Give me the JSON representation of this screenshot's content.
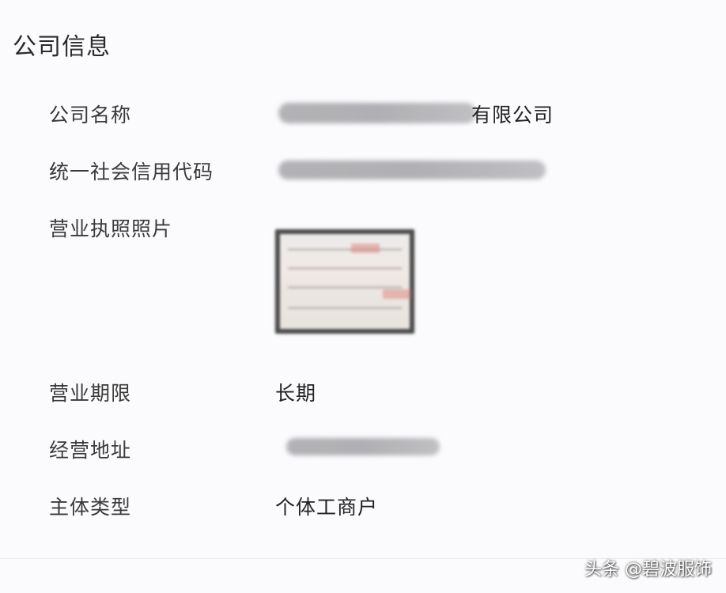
{
  "section": {
    "title": "公司信息"
  },
  "fields": [
    {
      "label": "公司名称",
      "value_visible": "有限公司",
      "redacted": true
    },
    {
      "label": "统一社会信用代码",
      "value_visible": "",
      "redacted": true
    },
    {
      "label": "营业执照照片",
      "value_visible": "",
      "redacted": true
    },
    {
      "label": "营业期限",
      "value_visible": "长期",
      "redacted": false
    },
    {
      "label": "经营地址",
      "value_visible": "",
      "redacted": true
    },
    {
      "label": "主体类型",
      "value_visible": "个体工商户",
      "redacted": false
    }
  ],
  "watermark": {
    "text": "头条 @碧波服饰"
  },
  "colors": {
    "background": "#fbfbfd",
    "label_text": "#3a3a3a",
    "value_text": "#222222",
    "title_text": "#2b2b2b"
  }
}
